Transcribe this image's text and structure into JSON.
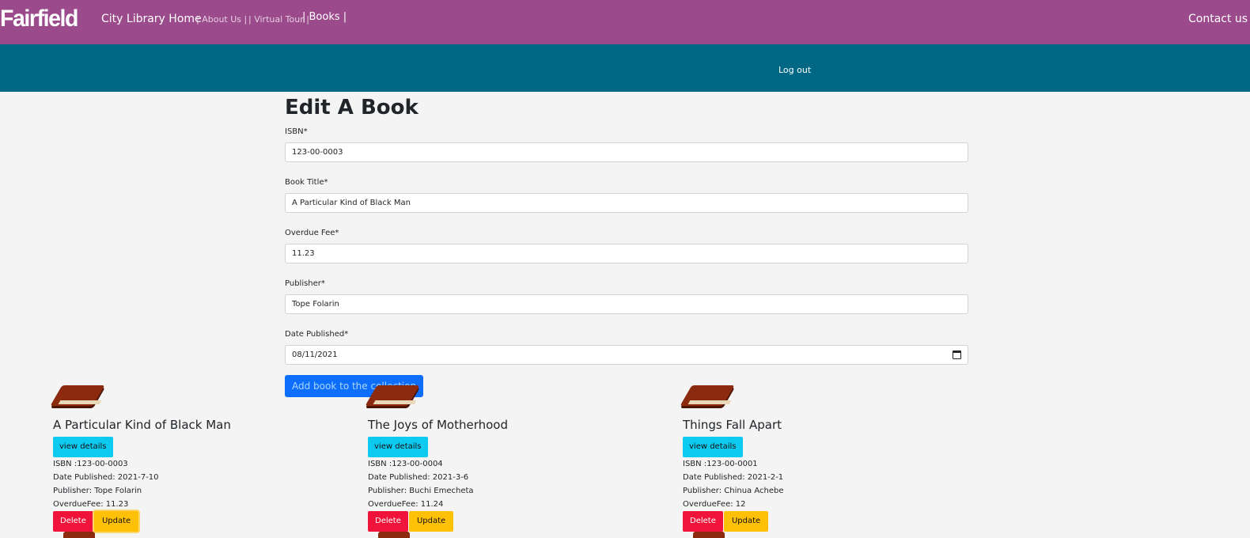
{
  "nav": {
    "brand": "Fairfield",
    "home": "City Library Home",
    "about": "| About Us |",
    "tour": "| Virtual Tour |",
    "books": "| Books |",
    "contact": "Contact us"
  },
  "subnav": {
    "logout": "Log out"
  },
  "form": {
    "title": "Edit A Book",
    "isbn_label": "ISBN*",
    "isbn_value": "123-00-0003",
    "title_label": "Book Title*",
    "title_value": "A Particular Kind of Black Man",
    "fee_label": "Overdue Fee*",
    "fee_value": "11.23",
    "publisher_label": "Publisher*",
    "publisher_value": "Tope Folarin",
    "date_label": "Date Published*",
    "date_value": "08/11/2021",
    "submit": "Add book to the collection"
  },
  "books": [
    {
      "title": "A Particular Kind of Black Man",
      "view": "view details",
      "isbn": "ISBN :123-00-0003",
      "date": "Date Published: 2021-7-10",
      "publisher": "Publisher: Tope Folarin",
      "fee": "OverdueFee: 11.23",
      "delete": "Delete",
      "update": "Update"
    },
    {
      "title": "The Joys of Motherhood",
      "view": "view details",
      "isbn": "ISBN :123-00-0004",
      "date": "Date Published: 2021-3-6",
      "publisher": "Publisher: Buchi Emecheta",
      "fee": "OverdueFee: 11.24",
      "delete": "Delete",
      "update": "Update"
    },
    {
      "title": "Things Fall Apart",
      "view": "view details",
      "isbn": "ISBN :123-00-0001",
      "date": "Date Published: 2021-2-1",
      "publisher": "Publisher: Chinua Achebe",
      "fee": "OverdueFee: 12",
      "delete": "Delete",
      "update": "Update"
    }
  ],
  "colors": {
    "topnav": "#9b4b8c",
    "subnav": "#006884",
    "primary": "#0d6efd",
    "info": "#0dcaf0",
    "danger": "#f0143a",
    "warning": "#ffc107"
  }
}
